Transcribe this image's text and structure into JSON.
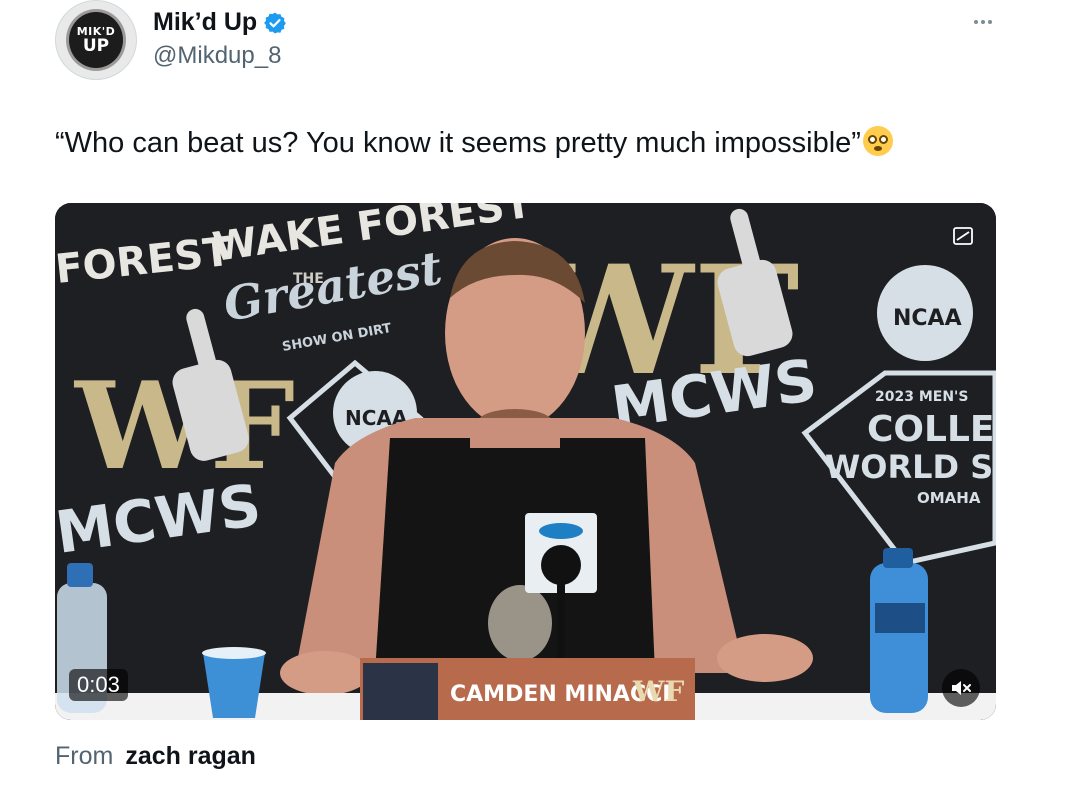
{
  "author": {
    "avatar_text_line1": "MIK'D",
    "avatar_text_line2": "UP",
    "display_name": "Mik’d Up",
    "handle": "@Mikdup_8",
    "verified": true
  },
  "tweet": {
    "text": "“Who can beat us? You know it seems pretty much impossible”",
    "emoji": "flushed-face"
  },
  "video": {
    "duration": "0:03",
    "nameplate": "CAMDEN MINACCI",
    "nameplate_logo": "WF",
    "backdrop": {
      "forest": "FOREST",
      "wake_forest": "WAKE FOREST",
      "the": "THE",
      "greatest": "Greatest",
      "show_on_dirt": "SHOW ON DIRT",
      "ncaa": "NCAA",
      "mcws": "MCWS",
      "year_mens": "2023 MEN'S",
      "college": "COLLEGE",
      "world_series": "WORLD SERIES",
      "omaha": "OMAHA",
      "wf": "WF"
    }
  },
  "source": {
    "prefix": "From",
    "name": "zach ragan"
  },
  "colors": {
    "text": "#0f1419",
    "secondary": "#536471",
    "verified": "#1d9bf0",
    "backdrop": "#1e1f22",
    "accent_gold": "#c9b98a"
  }
}
